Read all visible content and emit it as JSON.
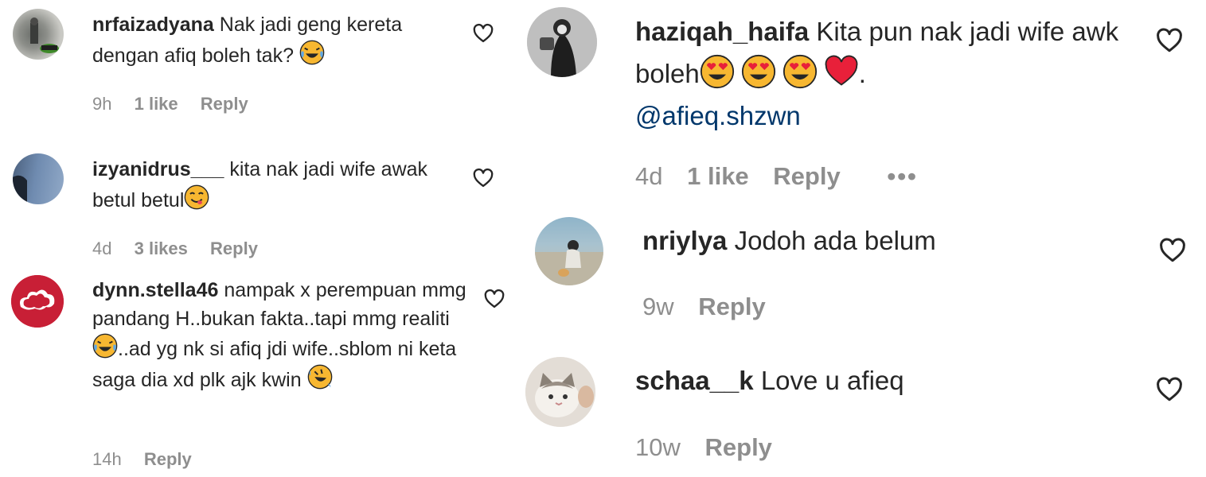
{
  "comments": [
    {
      "username": "nrfaizadyana",
      "text": "Nak jadi geng kereta dengan afiq boleh tak?",
      "emoji": "face-with-tears-of-joy",
      "time": "9h",
      "likes": "1 like",
      "reply": "Reply"
    },
    {
      "username": "izyanidrus___",
      "text": "kita nak jadi wife awak betul betul",
      "emoji": "face-savoring-food",
      "time": "4d",
      "likes": "3 likes",
      "reply": "Reply"
    },
    {
      "username": "dynn.stella46",
      "text": "nampak x perempuan mmg pandang H..bukan fakta..tapi mmg realiti",
      "text_after": "..ad yg nk si afiq jdi wife..sblom ni keta saga dia xd plk ajk kwin",
      "emoji": "face-with-tears-of-joy",
      "emoji_end": "rolling-on-floor-laughing",
      "time": "14h",
      "reply": "Reply"
    },
    {
      "username": "haziqah_haifa",
      "text": "Kita pun nak jadi wife awk boleh",
      "emojis": [
        "heart-eyes",
        "heart-eyes",
        "heart-eyes",
        "red-heart"
      ],
      "text_end": ".",
      "mention": "@afieq.shzwn",
      "time": "4d",
      "likes": "1 like",
      "reply": "Reply",
      "more": "•••"
    },
    {
      "username": "nriylya",
      "text": "Jodoh ada belum",
      "time": "9w",
      "reply": "Reply"
    },
    {
      "username": "schaa__k",
      "text": "Love u afieq",
      "time": "10w",
      "reply": "Reply"
    }
  ],
  "colors": {
    "text": "#262626",
    "meta": "#8e8e8e",
    "mention": "#00376b",
    "emoji_face": "#f7b731"
  }
}
